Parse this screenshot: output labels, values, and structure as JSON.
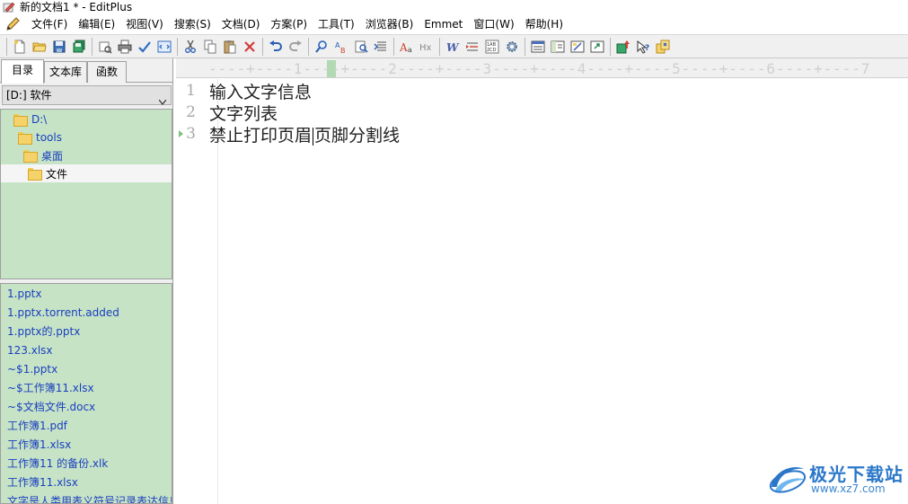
{
  "window": {
    "title": "新的文档1 * - EditPlus"
  },
  "menu": [
    "文件(F)",
    "编辑(E)",
    "视图(V)",
    "搜索(S)",
    "文档(D)",
    "方案(P)",
    "工具(T)",
    "浏览器(B)",
    "Emmet",
    "窗口(W)",
    "帮助(H)"
  ],
  "toolbar": {
    "icons": [
      "new-file-icon",
      "open-folder-icon",
      "save-icon",
      "save-all-icon",
      "print-preview-icon",
      "print-icon",
      "spell-check-icon",
      "browser-view-icon",
      "cut-icon",
      "copy-icon",
      "paste-icon",
      "delete-icon",
      "undo-icon",
      "redo-icon",
      "find-icon",
      "replace-icon",
      "find-in-files-icon",
      "goto-icon",
      "font-icon",
      "html-toolbar-icon",
      "word-wrap-icon",
      "format-icon",
      "line-number-icon",
      "preferences-icon",
      "window-list-icon",
      "cliptext-icon",
      "directory-icon",
      "output-icon",
      "ftp-upload-icon",
      "help-icon",
      "user-tools-icon"
    ]
  },
  "sidebar": {
    "tabs": [
      "目录",
      "文本库",
      "函数"
    ],
    "active_tab": 0,
    "drive": "[D:] 软件",
    "tree": [
      {
        "label": "D:\\"
      },
      {
        "label": "tools"
      },
      {
        "label": "桌面"
      },
      {
        "label": "文件",
        "selected": true
      }
    ],
    "files": [
      "1.pptx",
      "1.pptx.torrent.added",
      "1.pptx的.pptx",
      "123.xlsx",
      "~$1.pptx",
      "~$工作簿11.xlsx",
      "~$文档文件.docx",
      "工作簿1.pdf",
      "工作簿1.xlsx",
      "工作簿11 的备份.xlk",
      "工作簿11.xlsx",
      "文字是人类用表义符号记录表达信息"
    ]
  },
  "editor": {
    "ruler": "----+----1----+----2----+----3----+----4----+----5----+----6----+----7",
    "lines": [
      {
        "no": "1",
        "text": "输入文字信息"
      },
      {
        "no": "2",
        "text": "文字列表"
      },
      {
        "no": "3",
        "text_before_caret": "禁止打印页眉",
        "text_after_caret": "页脚分割线"
      }
    ]
  },
  "watermark": {
    "name": "极光下载站",
    "url": "www.xz7.com"
  },
  "colors": {
    "sidebar_bg": "#c6e3c6",
    "link": "#1a3fbf",
    "toolbar_bg": "#f0f0f0"
  }
}
